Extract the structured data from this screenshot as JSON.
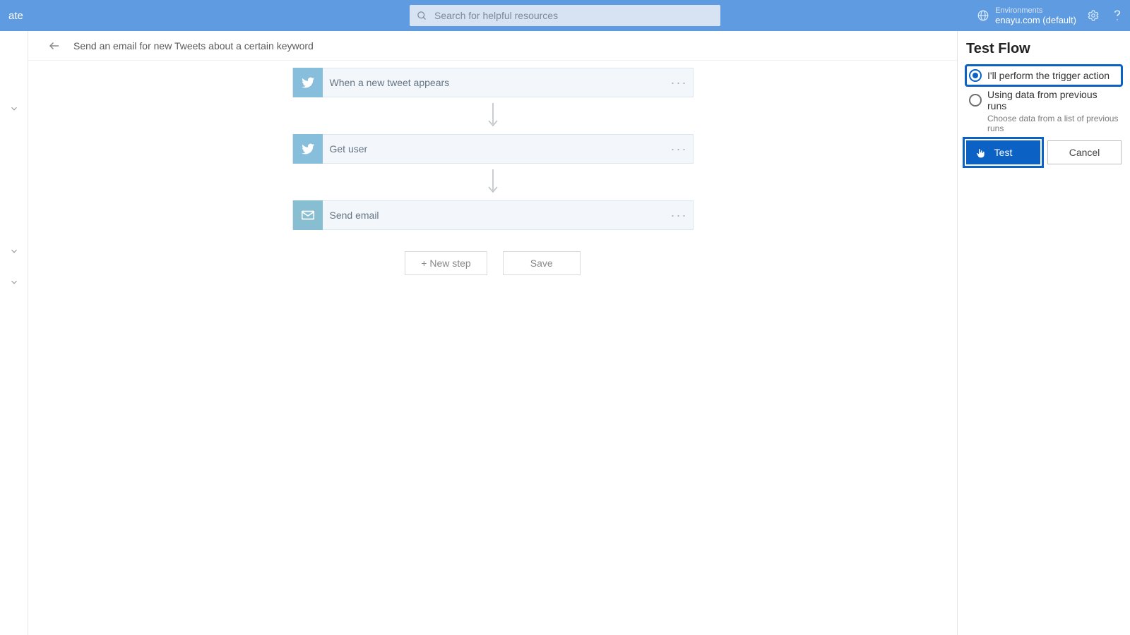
{
  "header": {
    "nav_title": "ate",
    "search_placeholder": "Search for helpful resources",
    "env_label": "Environments",
    "env_name": "enayu.com (default)"
  },
  "page": {
    "flow_name": "Send an email for new Tweets about a certain keyword",
    "new_step_label": "+ New step",
    "save_label": "Save"
  },
  "steps": [
    {
      "title": "When a new tweet appears",
      "icon": "twitter"
    },
    {
      "title": "Get user",
      "icon": "twitter"
    },
    {
      "title": "Send email",
      "icon": "mail"
    }
  ],
  "panel": {
    "title": "Test Flow",
    "option_perform": "I'll perform the trigger action",
    "option_previous": "Using data from previous runs",
    "previous_hint": "Choose data from a list of previous runs",
    "test_label": "Test",
    "cancel_label": "Cancel"
  }
}
